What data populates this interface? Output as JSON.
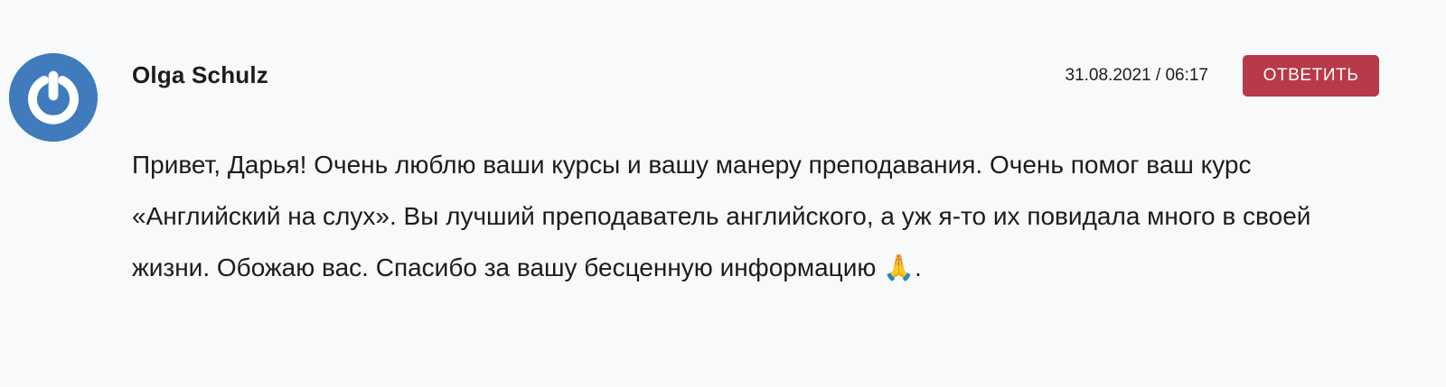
{
  "comment": {
    "author": "Olga Schulz",
    "timestamp": "31.08.2021 / 06:17",
    "reply_label": "ОТВЕТИТЬ",
    "body": "Привет, Дарья! Очень люблю ваши курсы и вашу манеру преподавания. Очень помог ваш курс «Английский на слух». Вы лучший преподаватель английского, а уж я-то их повидала много в своей жизни. Обожаю вас. Спасибо за вашу бесценную информацию ",
    "body_emoji": "🙏",
    "body_end": ".",
    "avatar_icon": "power-logo-icon"
  },
  "colors": {
    "background": "#f8f9fb",
    "avatar": "#3f7bbd",
    "reply_button": "#b8394a",
    "text": "#1c1c1e"
  }
}
